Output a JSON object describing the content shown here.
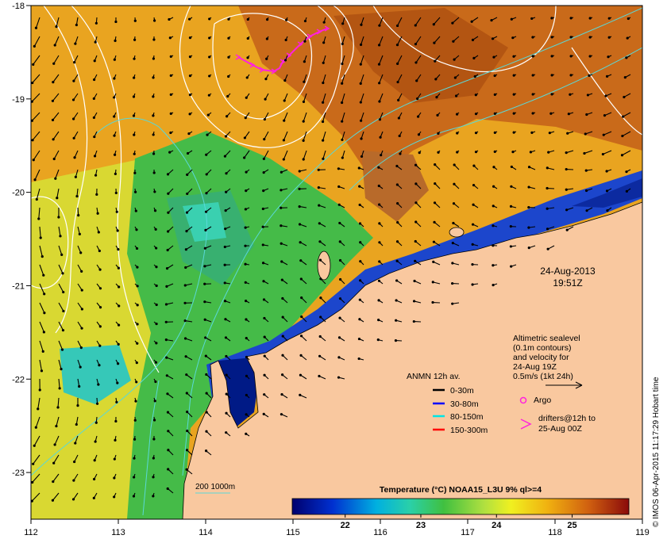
{
  "map": {
    "lon_range": [
      112,
      119
    ],
    "lat_range": [
      -23.5,
      -18
    ],
    "x_ticks": [
      "112",
      "113",
      "114",
      "115",
      "116",
      "117",
      "118",
      "119"
    ],
    "y_ticks": [
      "-18",
      "-19",
      "-20",
      "-21",
      "-22",
      "-23"
    ]
  },
  "date_label": {
    "date": "24-Aug-2013",
    "time": "19:51Z"
  },
  "altimetry_note": {
    "lines": [
      "Altimetric sealevel",
      "(0.1m contours)",
      "and velocity for",
      "24-Aug 19Z",
      "0.5m/s (1kt 24h)"
    ]
  },
  "anmn_legend": {
    "title": "ANMN 12h av.",
    "items": [
      {
        "label": "0-30m",
        "color": "#000000"
      },
      {
        "label": "30-80m",
        "color": "#0000ff"
      },
      {
        "label": "80-150m",
        "color": "#00e5e5"
      },
      {
        "label": "150-300m",
        "color": "#ff0000"
      }
    ]
  },
  "argo_label": "Argo",
  "drifter_label": [
    "drifters@12h to",
    "25-Aug 00Z"
  ],
  "isobath_label": "200  1000m",
  "colorbar": {
    "title": "Temperature (°C) NOAA15_L3U 9% ql>=4",
    "ticks": [
      "22",
      "23",
      "24",
      "25"
    ],
    "range": [
      21.3,
      25.75
    ]
  },
  "credit": "© IMOS 06-Apr-2015 11:17:29 Hobart time",
  "colors": {
    "land": "#f9c89f",
    "warm": "#e39b1a",
    "hot": "#c06018",
    "mid": "#d8d830",
    "cool": "#48c24a",
    "cyan": "#2ad0c8",
    "cold": "#1c3cc8",
    "coldest": "#001a8a",
    "drifter": "#ff22dd",
    "isobath": "#5ad8d8"
  }
}
